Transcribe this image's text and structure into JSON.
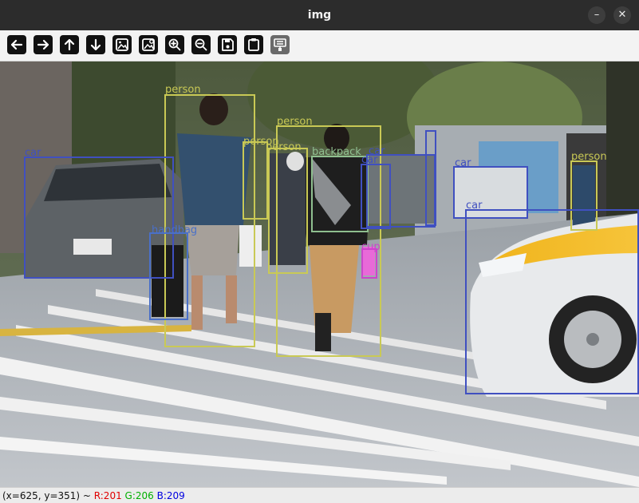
{
  "window": {
    "title": "img",
    "minimize_symbol": "–",
    "close_symbol": "✕"
  },
  "toolbar": {
    "buttons": [
      {
        "icon": "arrow-left-icon"
      },
      {
        "icon": "arrow-right-icon"
      },
      {
        "icon": "arrow-up-icon"
      },
      {
        "icon": "arrow-down-icon"
      },
      {
        "icon": "image-icon"
      },
      {
        "icon": "image-edit-icon"
      },
      {
        "icon": "zoom-in-icon"
      },
      {
        "icon": "zoom-out-icon"
      },
      {
        "icon": "save-icon"
      },
      {
        "icon": "clipboard-icon"
      },
      {
        "icon": "properties-icon",
        "disabled": true
      }
    ]
  },
  "detections": [
    {
      "label": "person",
      "color": "#c9c955"
    },
    {
      "label": "person",
      "color": "#c9c955"
    },
    {
      "label": "person",
      "color": "#c9c955"
    },
    {
      "label": "person",
      "color": "#c9c955"
    },
    {
      "label": "person",
      "color": "#c9c955"
    },
    {
      "label": "backpack",
      "color": "#8fbf8f"
    },
    {
      "label": "car",
      "color": "#4050c0"
    },
    {
      "label": "car",
      "color": "#4050c0"
    },
    {
      "label": "car",
      "color": "#4050c0"
    },
    {
      "label": "car",
      "color": "#4050c0"
    },
    {
      "label": "car",
      "color": "#4050c0"
    },
    {
      "label": "handbag",
      "color": "#4a70c8"
    },
    {
      "label": "cup",
      "color": "#cc44cc"
    },
    {
      "label": "",
      "color": "#4050c0"
    }
  ],
  "status": {
    "coords": "(x=625, y=351) ~ ",
    "r": "R:201",
    "g": "G:206",
    "b": "B:209",
    "r_color": "#e00000",
    "g_color": "#00b000",
    "b_color": "#0000e0"
  }
}
